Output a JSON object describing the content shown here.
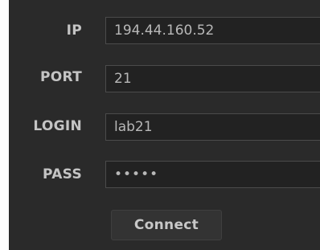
{
  "form": {
    "ip": {
      "label": "IP",
      "value": "194.44.160.52"
    },
    "port": {
      "label": "PORT",
      "value": "21"
    },
    "login": {
      "label": "LOGIN",
      "value": "lab21"
    },
    "pass": {
      "label": "PASS",
      "value": "•••••"
    },
    "connect_label": "Connect"
  },
  "colors": {
    "background": "#2a2a2a",
    "field_bg": "#222222",
    "field_border": "#4b4b4b",
    "text": "#c4c4c4"
  }
}
